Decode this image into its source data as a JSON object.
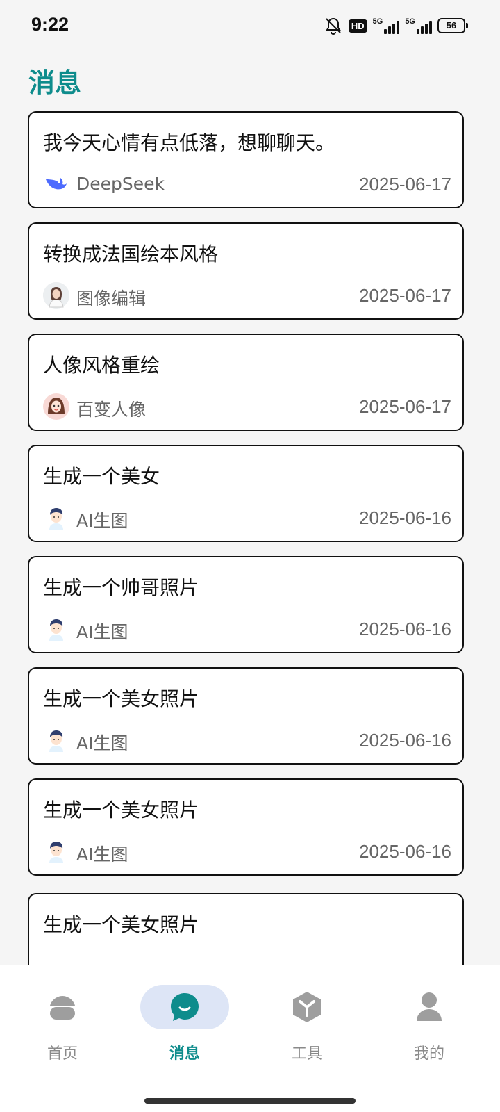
{
  "status": {
    "time": "9:22",
    "hd": "HD",
    "net1": "5G",
    "net2": "5G",
    "battery": "56"
  },
  "page": {
    "title": "消息"
  },
  "messages": [
    {
      "title": "我今天心情有点低落，想聊聊天。",
      "app": "DeepSeek",
      "date": "2025-06-17",
      "icon": "deepseek-whale-icon"
    },
    {
      "title": "转换成法国绘本风格",
      "app": "图像编辑",
      "date": "2025-06-17",
      "icon": "woman-avatar-icon"
    },
    {
      "title": "人像风格重绘",
      "app": "百变人像",
      "date": "2025-06-17",
      "icon": "girl-avatar-icon"
    },
    {
      "title": "生成一个美女",
      "app": "AI生图",
      "date": "2025-06-16",
      "icon": "man-avatar-icon"
    },
    {
      "title": "生成一个帅哥照片",
      "app": "AI生图",
      "date": "2025-06-16",
      "icon": "man-avatar-icon"
    },
    {
      "title": "生成一个美女照片",
      "app": "AI生图",
      "date": "2025-06-16",
      "icon": "man-avatar-icon"
    },
    {
      "title": "生成一个美女照片",
      "app": "AI生图",
      "date": "2025-06-16",
      "icon": "man-avatar-icon"
    },
    {
      "title": "生成一个美女照片",
      "app": "",
      "date": "",
      "icon": ""
    }
  ],
  "nav": [
    {
      "label": "首页",
      "icon": "home-icon",
      "active": false
    },
    {
      "label": "消息",
      "icon": "chat-bubble-icon",
      "active": true
    },
    {
      "label": "工具",
      "icon": "toolbox-icon",
      "active": false
    },
    {
      "label": "我的",
      "icon": "person-icon",
      "active": false
    }
  ],
  "colors": {
    "accent": "#0e8c8c",
    "nav_active_bg": "#dde5f6",
    "nav_inactive": "#8a8a8a"
  }
}
